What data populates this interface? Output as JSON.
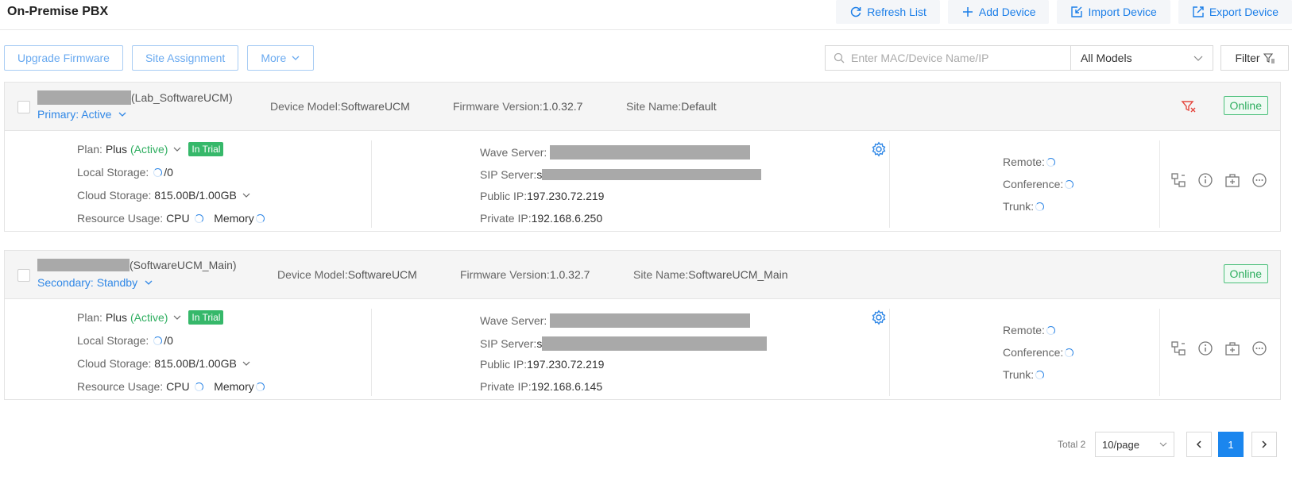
{
  "header": {
    "title": "On-Premise PBX",
    "actions": [
      {
        "label": "Refresh List",
        "icon": "refresh-icon"
      },
      {
        "label": "Add Device",
        "icon": "plus-icon"
      },
      {
        "label": "Import Device",
        "icon": "import-icon"
      },
      {
        "label": "Export Device",
        "icon": "export-icon"
      }
    ]
  },
  "toolbar": {
    "upgrade_label": "Upgrade Firmware",
    "site_label": "Site Assignment",
    "more_label": "More",
    "search_placeholder": "Enter MAC/Device Name/IP",
    "model_selected": "All Models",
    "filter_label": "Filter"
  },
  "labels": {
    "device_model": "Device Model:",
    "firmware": "Firmware Version:",
    "site_name": "Site Name:",
    "plan": "Plan:",
    "local_storage": "Local Storage:",
    "cloud_storage": "Cloud Storage:",
    "resource_usage": "Resource Usage:",
    "cpu": "CPU",
    "memory": "Memory",
    "wave_server": "Wave Server:",
    "sip_server": "SIP Server:",
    "public_ip": "Public IP:",
    "private_ip": "Private IP:",
    "remote": "Remote:",
    "conference": "Conference:",
    "trunk": "Trunk:"
  },
  "devices": [
    {
      "name_suffix": "(Lab_SoftwareUCM)",
      "role": "Primary: Active",
      "model": "SoftwareUCM",
      "firmware": "1.0.32.7",
      "site": "Default",
      "status": "Online",
      "plan": "Plus",
      "plan_state": "(Active)",
      "trial": "In Trial",
      "local_storage": "/0",
      "cloud_storage": "815.00B/1.00GB",
      "sip_prefix": "s",
      "public_ip": "197.230.72.219",
      "private_ip": "192.168.6.250"
    },
    {
      "name_suffix": "(SoftwareUCM_Main)",
      "role": "Secondary: Standby",
      "model": "SoftwareUCM",
      "firmware": "1.0.32.7",
      "site": "SoftwareUCM_Main",
      "status": "Online",
      "plan": "Plus",
      "plan_state": "(Active)",
      "trial": "In Trial",
      "local_storage": "/0",
      "cloud_storage": "815.00B/1.00GB",
      "sip_prefix": "s",
      "public_ip": "197.230.72.219",
      "private_ip": "192.168.6.145"
    }
  ],
  "pagination": {
    "total": "Total 2",
    "page_size": "10/page",
    "current_page": "1",
    "prev_icon": "chevron-left-icon",
    "next_icon": "chevron-right-icon"
  },
  "colors": {
    "accent": "#1b7ee8",
    "online": "#2fae60",
    "header_bg": "#f5f5f5"
  }
}
